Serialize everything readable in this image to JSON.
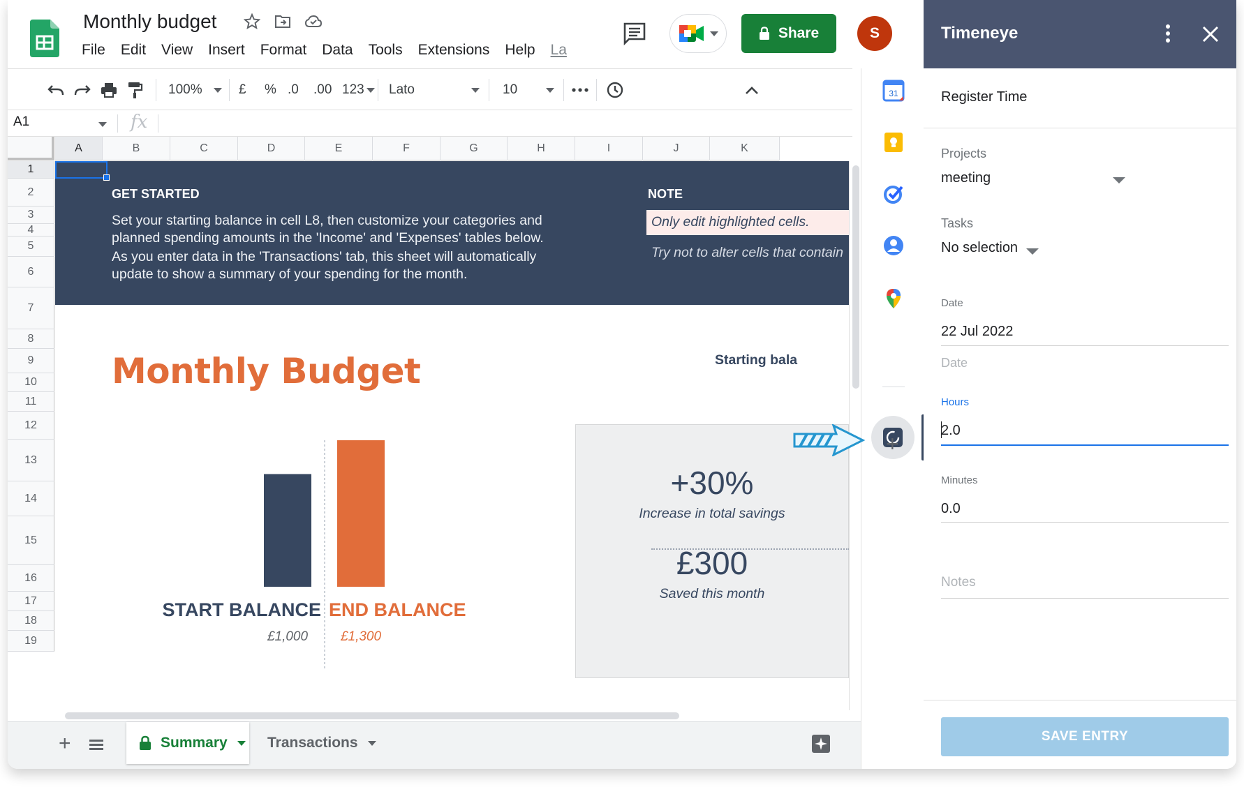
{
  "header": {
    "doc_title": "Monthly budget",
    "menu": [
      "File",
      "Edit",
      "View",
      "Insert",
      "Format",
      "Data",
      "Tools",
      "Extensions",
      "Help"
    ],
    "last_edit": "La",
    "share_label": "Share",
    "avatar_initial": "S",
    "colors": {
      "share": "#188038",
      "avatar": "#bf360c"
    }
  },
  "toolbar": {
    "zoom": "100%",
    "currency": "£",
    "percent": "%",
    "dec_less": ".0",
    "dec_more": ".00",
    "format_more": "123",
    "font": "Lato",
    "font_size": "10"
  },
  "formula_bar": {
    "cell_ref": "A1",
    "fx": "fx"
  },
  "grid": {
    "columns": [
      "A",
      "B",
      "C",
      "D",
      "E",
      "F",
      "G",
      "H",
      "I",
      "J",
      "K"
    ],
    "rows": [
      "1",
      "2",
      "3",
      "4",
      "5",
      "6",
      "7",
      "8",
      "9",
      "10",
      "11",
      "12",
      "13",
      "14",
      "15",
      "16",
      "17",
      "18",
      "19"
    ]
  },
  "sheet": {
    "get_started_heading": "GET STARTED",
    "get_started_p1": "Set your starting balance in cell L8, then customize your categories and planned spending amounts in the 'Income' and 'Expenses' tables below.",
    "get_started_p2": "As you enter data in the 'Transactions' tab, this sheet will automatically update to show a summary of your spending for the month.",
    "note_heading": "NOTE",
    "note_highlight": "Only edit highlighted cells.",
    "note_text": "Try not to alter cells that contain",
    "title": "Monthly Budget",
    "starting_balance_label": "Starting bala",
    "kpi_1_value": "+30%",
    "kpi_1_label": "Increase in total savings",
    "kpi_2_value": "£300",
    "kpi_2_label": "Saved this month",
    "colors": {
      "banner": "#374760",
      "accent": "#e16d3a"
    }
  },
  "chart_data": {
    "type": "bar",
    "categories": [
      "START BALANCE",
      "END BALANCE"
    ],
    "values": [
      1000,
      1300
    ],
    "value_labels": [
      "£1,000",
      "£1,300"
    ],
    "colors": [
      "#374760",
      "#e16d3a"
    ],
    "ylim": [
      0,
      1300
    ]
  },
  "tabs": {
    "items": [
      {
        "label": "Summary",
        "active": true
      },
      {
        "label": "Transactions",
        "active": false
      }
    ]
  },
  "side_rail": {
    "icons": [
      "calendar-icon",
      "keep-icon",
      "tasks-icon",
      "contacts-icon",
      "maps-icon",
      "timeneye-icon",
      "add-icon"
    ],
    "calendar_day": "31"
  },
  "panel": {
    "title": "Timeneye",
    "subtitle": "Register Time",
    "projects_label": "Projects",
    "projects_value": "meeting",
    "tasks_label": "Tasks",
    "tasks_value": "No selection",
    "date_label": "Date",
    "date_value": "22 Jul 2022",
    "date_placeholder": "Date",
    "hours_label": "Hours",
    "hours_value": "2.0",
    "minutes_label": "Minutes",
    "minutes_value": "0.0",
    "notes_placeholder": "Notes",
    "save_label": "SAVE ENTRY",
    "colors": {
      "header": "#4a5570",
      "focus": "#1a73e8",
      "save": "#9fcbe8"
    }
  }
}
